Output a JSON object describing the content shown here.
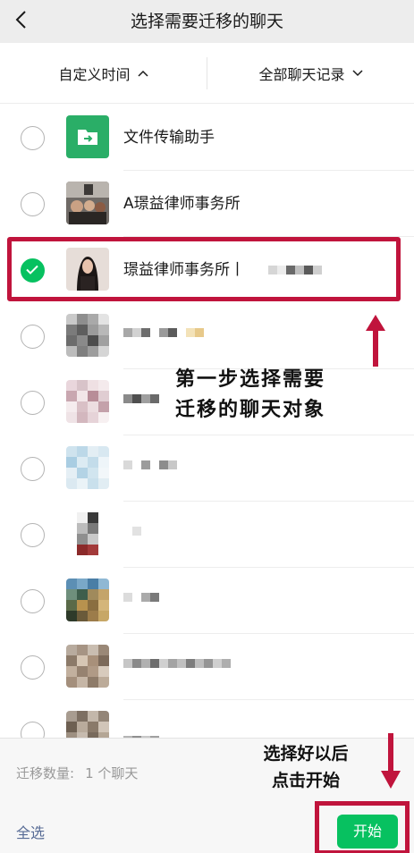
{
  "header": {
    "title": "选择需要迁移的聊天",
    "back_icon": "chevron-left-icon"
  },
  "filters": {
    "left_label": "自定义时间",
    "left_icon": "chevron-up-icon",
    "right_label": "全部聊天记录",
    "right_icon": "chevron-down-icon"
  },
  "chats": [
    {
      "name": "文件传输助手",
      "selected": false,
      "avatar": "file-transfer-icon"
    },
    {
      "name": "A璟益律师事务所",
      "selected": false,
      "avatar": "photo"
    },
    {
      "name": "璟益律师事务所丨",
      "selected": true,
      "avatar": "photo"
    },
    {
      "name": "",
      "selected": false,
      "avatar": "pixelated"
    },
    {
      "name": "",
      "selected": false,
      "avatar": "pixelated"
    },
    {
      "name": "",
      "selected": false,
      "avatar": "pixelated"
    },
    {
      "name": "",
      "selected": false,
      "avatar": "pixelated"
    },
    {
      "name": "",
      "selected": false,
      "avatar": "pixelated"
    },
    {
      "name": "",
      "selected": false,
      "avatar": "pixelated"
    },
    {
      "name": "",
      "selected": false,
      "avatar": "pixelated"
    }
  ],
  "annotations": {
    "step1_line1": "第一步选择需要",
    "step1_line2": "迁移的聊天对象",
    "step2_line1": "选择好以后",
    "step2_line2": "点击开始"
  },
  "footer": {
    "count_label": "迁移数量:",
    "count_value": "1 个聊天",
    "select_all": "全选",
    "start": "开始"
  },
  "colors": {
    "accent": "#07c160",
    "highlight": "#c0143c",
    "link": "#576b95"
  }
}
